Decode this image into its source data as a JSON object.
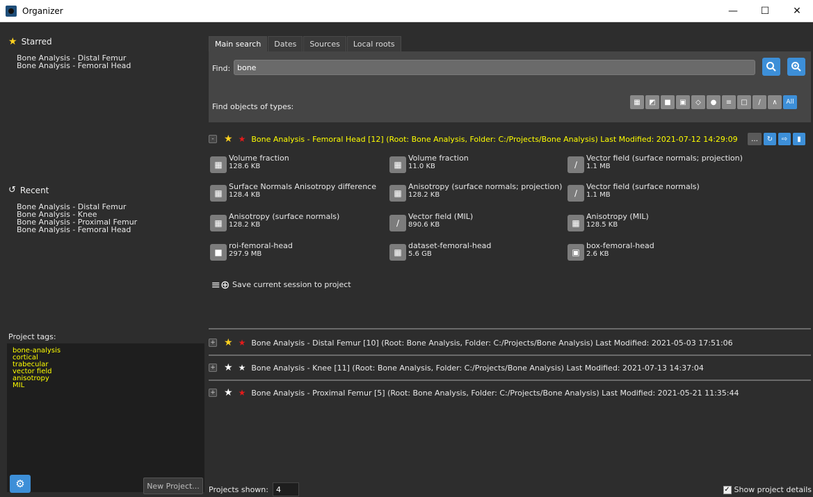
{
  "window": {
    "title": "Organizer"
  },
  "starred": {
    "heading": "Starred",
    "items": [
      "Bone Analysis - Distal Femur",
      "Bone Analysis - Femoral Head"
    ]
  },
  "recent": {
    "heading": "Recent",
    "items": [
      "Bone Analysis - Distal Femur",
      "Bone Analysis - Knee",
      "Bone Analysis - Proximal Femur",
      "Bone Analysis - Femoral Head"
    ]
  },
  "tags": {
    "label": "Project tags:",
    "items": [
      "bone-analysis",
      "cortical",
      "trabecular",
      "vector field",
      "anisotropy",
      "MIL"
    ]
  },
  "new_project_label": "New Project...",
  "tabs": [
    "Main search",
    "Dates",
    "Sources",
    "Local roots"
  ],
  "search": {
    "find_label": "Find:",
    "value": "bone",
    "types_label": "Find objects of types:",
    "all_label": "All"
  },
  "projects": [
    {
      "text": "Bone Analysis - Femoral Head [12] (Root: Bone Analysis, Folder: C:/Projects/Bone Analysis) Last Modified: 2021-07-12 14:29:09",
      "expanded": true,
      "toggle": "-",
      "pinned": true
    },
    {
      "text": "Bone Analysis - Distal Femur [10] (Root: Bone Analysis, Folder: C:/Projects/Bone Analysis) Last Modified: 2021-05-03 17:51:06",
      "expanded": false,
      "toggle": "+",
      "pinned": true
    },
    {
      "text": "Bone Analysis - Knee [11] (Root: Bone Analysis, Folder: C:/Projects/Bone Analysis) Last Modified: 2021-07-13 14:37:04",
      "expanded": false,
      "toggle": "+",
      "pinned": false
    },
    {
      "text": "Bone Analysis - Proximal Femur [5] (Root: Bone Analysis, Folder: C:/Projects/Bone Analysis) Last Modified: 2021-05-21 11:35:44",
      "expanded": false,
      "toggle": "+",
      "pinned": true
    }
  ],
  "objects": [
    {
      "name": "Volume fraction",
      "size": "128.6 KB",
      "icon": "grid-icon"
    },
    {
      "name": "Volume fraction",
      "size": "11.0 KB",
      "icon": "grid-icon"
    },
    {
      "name": "Vector field (surface normals; projection)",
      "size": "1.1 MB",
      "icon": "vector-icon"
    },
    {
      "name": "Surface Normals Anisotropy difference",
      "size": "128.4 KB",
      "icon": "grid-icon"
    },
    {
      "name": "Anisotropy (surface normals; projection)",
      "size": "128.2 KB",
      "icon": "grid-icon"
    },
    {
      "name": "Vector field (surface normals)",
      "size": "1.1 MB",
      "icon": "vector-icon"
    },
    {
      "name": "Anisotropy (surface normals)",
      "size": "128.2 KB",
      "icon": "grid-icon"
    },
    {
      "name": "Vector field (MIL)",
      "size": "890.6 KB",
      "icon": "vector-icon"
    },
    {
      "name": "Anisotropy (MIL)",
      "size": "128.5 KB",
      "icon": "grid-icon"
    },
    {
      "name": "roi-femoral-head",
      "size": "297.9 MB",
      "icon": "roi-icon"
    },
    {
      "name": "dataset-femoral-head",
      "size": "5.6 GB",
      "icon": "grid-icon"
    },
    {
      "name": "box-femoral-head",
      "size": "2.6 KB",
      "icon": "box-icon"
    }
  ],
  "save_session_label": "Save current session to project",
  "projects_shown_label": "Projects shown:",
  "projects_shown_value": "4",
  "show_details_label": "Show project details",
  "colors": {
    "accent": "#3d8fd8",
    "star": "#ffd21f",
    "pin": "#e31b1b",
    "highlight": "#ffff00"
  }
}
